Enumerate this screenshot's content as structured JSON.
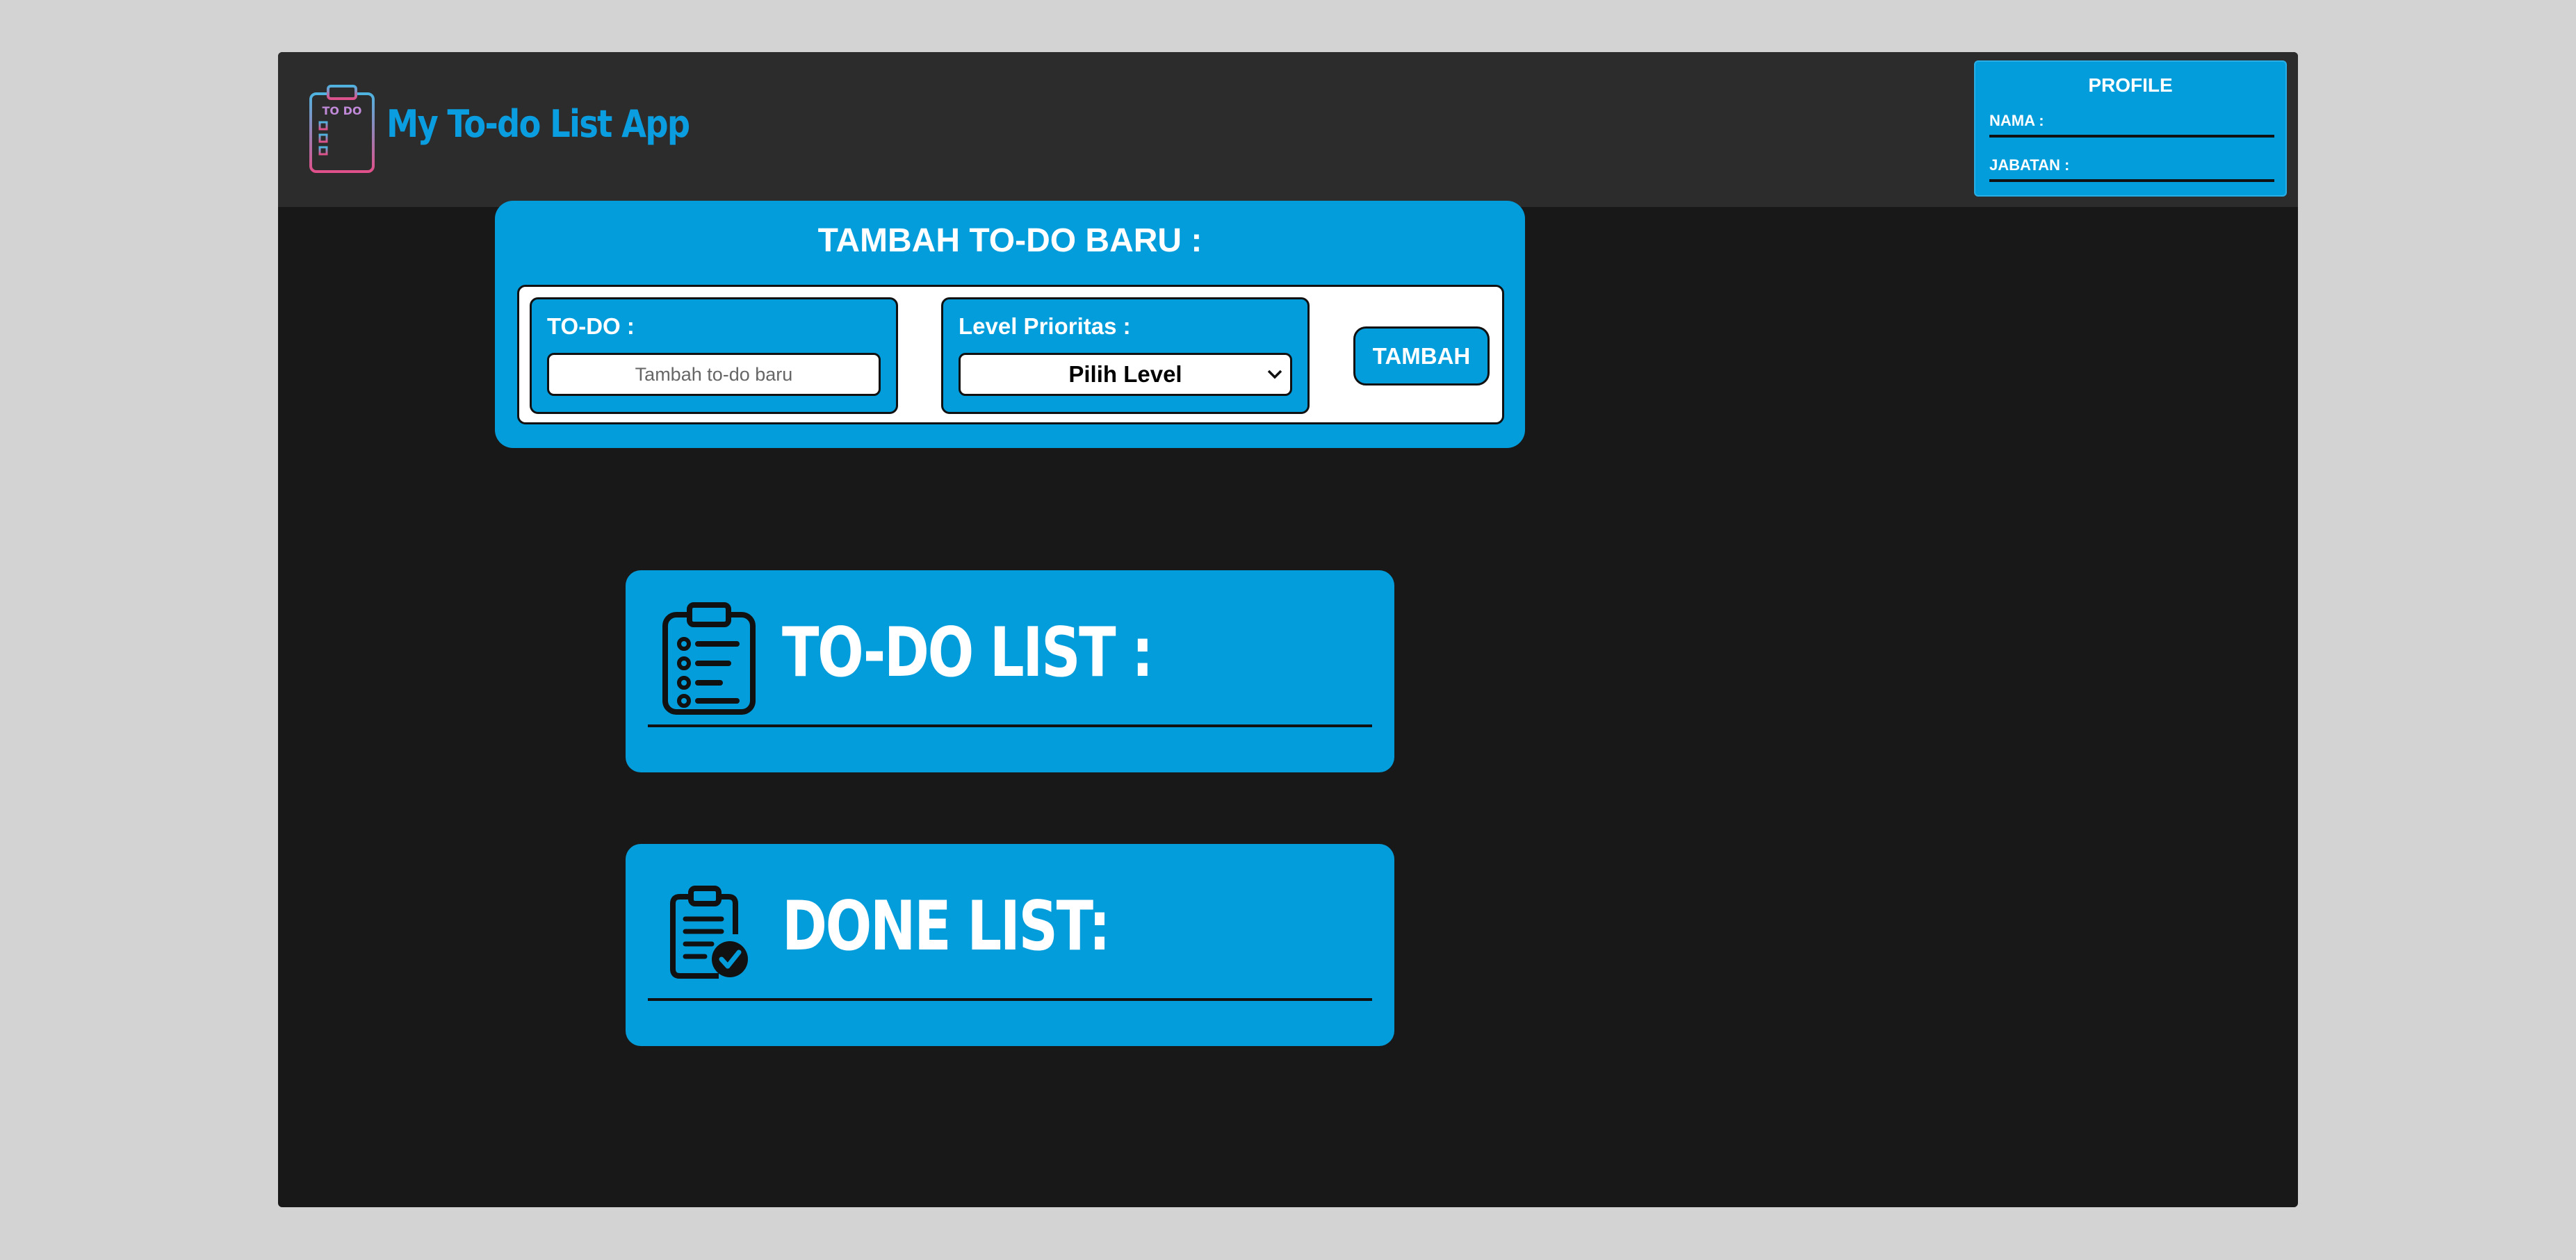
{
  "app": {
    "title": "My To-do List App",
    "logo_text": "TO DO"
  },
  "profile": {
    "title": "PROFILE",
    "name_label": "NAMA :",
    "position_label": "JABATAN :"
  },
  "add_todo": {
    "title": "TAMBAH TO-DO BARU :",
    "todo_label": "TO-DO :",
    "todo_placeholder": "Tambah to-do baru",
    "level_label": "Level Prioritas :",
    "level_selected": "Pilih Level",
    "add_button": "TAMBAH"
  },
  "todo_list": {
    "heading": "TO-DO LIST :",
    "icon": "clipboard-list-icon"
  },
  "done_list": {
    "heading": "DONE LIST:",
    "icon": "clipboard-check-icon"
  },
  "colors": {
    "accent": "#049ddb",
    "topbar": "#2c2c2c",
    "background": "#181818"
  }
}
